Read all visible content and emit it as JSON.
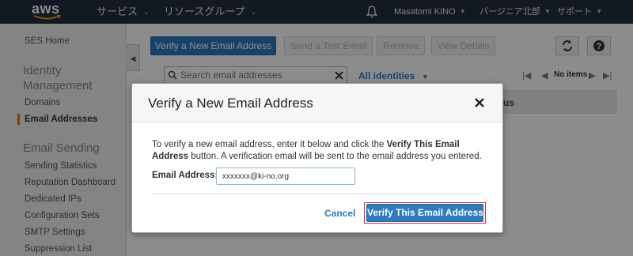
{
  "topbar": {
    "logo": "aws",
    "services": "サービス",
    "resource_groups": "リソースグループ",
    "user": "Masatomi KINO",
    "region": "バージニア北部",
    "support": "サポート"
  },
  "sidebar": {
    "ses_home": "SES Home",
    "identity_heading": "Identity Management",
    "identity_items": [
      "Domains",
      "Email Addresses"
    ],
    "sending_heading": "Email Sending",
    "sending_items": [
      "Sending Statistics",
      "Reputation Dashboard",
      "Dedicated IPs",
      "Configuration Sets",
      "SMTP Settings",
      "Suppression List"
    ],
    "active_item": "Email Addresses"
  },
  "toolbar": {
    "verify_new": "Verify a New Email Address",
    "send_test": "Send a Test Email",
    "remove": "Remove",
    "view_details": "View Details"
  },
  "search": {
    "placeholder": "Search email addresses",
    "filter": "All identities"
  },
  "pager": {
    "label": "No items"
  },
  "grid": {
    "partial_column": "us"
  },
  "modal": {
    "title": "Verify a New Email Address",
    "desc_pre": "To verify a new email address, enter it below and click the ",
    "desc_bold": "Verify This Email Address",
    "desc_post": " button. A verification email will be sent to the email address you entered.",
    "field_label": "Email Address:",
    "field_value": "xxxxxxx@ki-no.org",
    "cancel": "Cancel",
    "verify": "Verify This Email Address"
  },
  "colors": {
    "nav_bg": "#232f3e",
    "primary": "#2b7bc1",
    "accent": "#e47911",
    "highlight_frame": "#e5262a"
  }
}
